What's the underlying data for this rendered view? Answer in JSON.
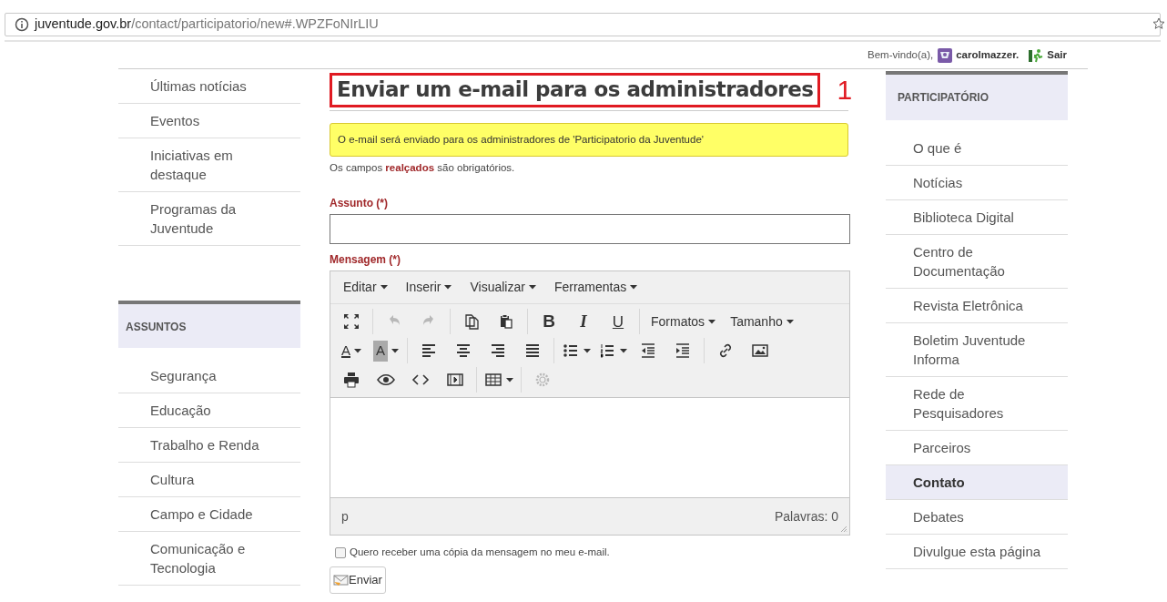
{
  "address_bar": {
    "host": "juventude.gov.br",
    "path": "/contact/participatorio/new#.WPZFoNIrLIU"
  },
  "user_bar": {
    "greeting": "Bem-vindo(a),",
    "username": "carolmazzer.",
    "logout": "Sair"
  },
  "left_sidebar": {
    "items": [
      {
        "label": "Últimas notícias"
      },
      {
        "label": "Eventos"
      },
      {
        "label": "Iniciativas em destaque"
      },
      {
        "label": "Programas da Juventude"
      }
    ],
    "section": {
      "title": "ASSUNTOS",
      "items": [
        {
          "label": "Segurança"
        },
        {
          "label": "Educação"
        },
        {
          "label": "Trabalho e Renda"
        },
        {
          "label": "Cultura"
        },
        {
          "label": "Campo e Cidade"
        },
        {
          "label": "Comunicação e Tecnologia"
        }
      ]
    }
  },
  "main": {
    "title": "Enviar um e-mail para os administradores",
    "annotation_label": "1",
    "notice": "O e-mail será enviado para os administradores de 'Participatorio da Juventude'",
    "required_note": "Os campos **realçados** são obrigatórios.",
    "subject": {
      "label": "Assunto (*)"
    },
    "message": {
      "label": "Mensagem (*)",
      "menus": [
        "Editar",
        "Inserir",
        "Visualizar",
        "Ferramentas"
      ],
      "toolbar_rows": [
        [
          [
            {
              "kind": "icon",
              "disabled": false
            }
          ],
          [
            {
              "kind": "icon",
              "disabled": true
            },
            {
              "kind": "icon",
              "disabled": true
            }
          ],
          [
            {
              "kind": "icon",
              "disabled": false
            },
            {
              "kind": "icon",
              "disabled": false
            }
          ],
          [
            {
              "kind": "bold",
              "label": "B",
              "disabled": false
            },
            {
              "kind": "italic",
              "label": "I",
              "disabled": false
            },
            {
              "kind": "underline",
              "label": "U",
              "disabled": false
            }
          ],
          [
            {
              "kind": "menu",
              "label": "Formatos",
              "disabled": false
            },
            {
              "kind": "menu",
              "label": "Tamanho",
              "disabled": false
            }
          ]
        ],
        [
          [
            {
              "kind": "forecolor",
              "label": "A",
              "disabled": false
            },
            {
              "kind": "backcolor",
              "label": "A",
              "disabled": false
            }
          ],
          [
            {
              "kind": "icon",
              "disabled": false
            },
            {
              "kind": "icon",
              "disabled": false
            },
            {
              "kind": "icon",
              "disabled": false
            },
            {
              "kind": "icon",
              "disabled": false
            }
          ],
          [
            {
              "kind": "spliticon",
              "disabled": false
            },
            {
              "kind": "spliticon",
              "disabled": false
            },
            {
              "kind": "icon",
              "disabled": false
            },
            {
              "kind": "icon",
              "disabled": false
            }
          ],
          [
            {
              "kind": "icon",
              "disabled": false
            },
            {
              "kind": "icon",
              "disabled": false
            }
          ]
        ],
        [
          [
            {
              "kind": "icon",
              "disabled": false
            },
            {
              "kind": "icon",
              "disabled": false
            },
            {
              "kind": "icon",
              "disabled": false
            },
            {
              "kind": "icon",
              "disabled": false
            }
          ],
          [
            {
              "kind": "spliticon",
              "disabled": false
            }
          ],
          [
            {
              "kind": "icon",
              "disabled": true
            }
          ]
        ]
      ],
      "path": "p",
      "word_count": "Palavras: 0"
    },
    "copy_option": {
      "label": "Quero receber uma cópia da mensagem no meu e-mail.",
      "checked": false
    },
    "submit": "Enviar"
  },
  "right_sidebar": {
    "title": "PARTICIPATÓRIO",
    "items": [
      {
        "label": "O que é",
        "selected": false
      },
      {
        "label": "Notícias",
        "selected": false
      },
      {
        "label": "Biblioteca Digital",
        "selected": false
      },
      {
        "label": "Centro de Documentação",
        "selected": false
      },
      {
        "label": "Revista Eletrônica",
        "selected": false
      },
      {
        "label": "Boletim Juventude Informa",
        "selected": false
      },
      {
        "label": "Rede de Pesquisadores",
        "selected": false
      },
      {
        "label": "Parceiros",
        "selected": false
      },
      {
        "label": "Contato",
        "selected": true
      },
      {
        "label": "Debates",
        "selected": false
      },
      {
        "label": "Divulgue esta página",
        "selected": false
      }
    ]
  }
}
